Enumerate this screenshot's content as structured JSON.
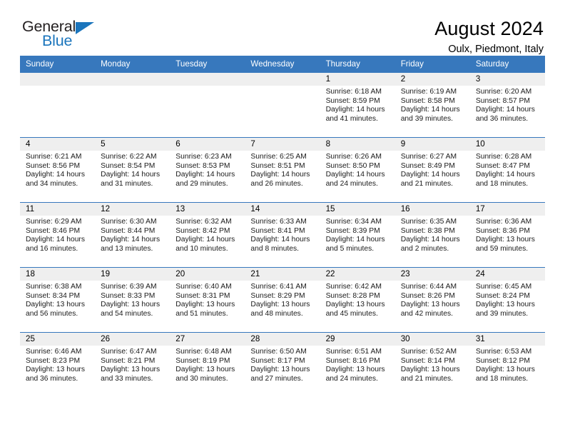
{
  "brand": {
    "name_top": "General",
    "name_bottom": "Blue",
    "accent_color": "#1b75bc"
  },
  "header": {
    "title": "August 2024",
    "subtitle": "Oulx, Piedmont, Italy"
  },
  "calendar": {
    "header_bg": "#3778bd",
    "daynum_bg": "#efefef",
    "weekdays": [
      "Sunday",
      "Monday",
      "Tuesday",
      "Wednesday",
      "Thursday",
      "Friday",
      "Saturday"
    ],
    "weeks": [
      [
        {
          "day": "",
          "empty": true
        },
        {
          "day": "",
          "empty": true
        },
        {
          "day": "",
          "empty": true
        },
        {
          "day": "",
          "empty": true
        },
        {
          "day": "1",
          "sunrise": "Sunrise: 6:18 AM",
          "sunset": "Sunset: 8:59 PM",
          "daylight1": "Daylight: 14 hours",
          "daylight2": "and 41 minutes."
        },
        {
          "day": "2",
          "sunrise": "Sunrise: 6:19 AM",
          "sunset": "Sunset: 8:58 PM",
          "daylight1": "Daylight: 14 hours",
          "daylight2": "and 39 minutes."
        },
        {
          "day": "3",
          "sunrise": "Sunrise: 6:20 AM",
          "sunset": "Sunset: 8:57 PM",
          "daylight1": "Daylight: 14 hours",
          "daylight2": "and 36 minutes."
        }
      ],
      [
        {
          "day": "4",
          "sunrise": "Sunrise: 6:21 AM",
          "sunset": "Sunset: 8:56 PM",
          "daylight1": "Daylight: 14 hours",
          "daylight2": "and 34 minutes."
        },
        {
          "day": "5",
          "sunrise": "Sunrise: 6:22 AM",
          "sunset": "Sunset: 8:54 PM",
          "daylight1": "Daylight: 14 hours",
          "daylight2": "and 31 minutes."
        },
        {
          "day": "6",
          "sunrise": "Sunrise: 6:23 AM",
          "sunset": "Sunset: 8:53 PM",
          "daylight1": "Daylight: 14 hours",
          "daylight2": "and 29 minutes."
        },
        {
          "day": "7",
          "sunrise": "Sunrise: 6:25 AM",
          "sunset": "Sunset: 8:51 PM",
          "daylight1": "Daylight: 14 hours",
          "daylight2": "and 26 minutes."
        },
        {
          "day": "8",
          "sunrise": "Sunrise: 6:26 AM",
          "sunset": "Sunset: 8:50 PM",
          "daylight1": "Daylight: 14 hours",
          "daylight2": "and 24 minutes."
        },
        {
          "day": "9",
          "sunrise": "Sunrise: 6:27 AM",
          "sunset": "Sunset: 8:49 PM",
          "daylight1": "Daylight: 14 hours",
          "daylight2": "and 21 minutes."
        },
        {
          "day": "10",
          "sunrise": "Sunrise: 6:28 AM",
          "sunset": "Sunset: 8:47 PM",
          "daylight1": "Daylight: 14 hours",
          "daylight2": "and 18 minutes."
        }
      ],
      [
        {
          "day": "11",
          "sunrise": "Sunrise: 6:29 AM",
          "sunset": "Sunset: 8:46 PM",
          "daylight1": "Daylight: 14 hours",
          "daylight2": "and 16 minutes."
        },
        {
          "day": "12",
          "sunrise": "Sunrise: 6:30 AM",
          "sunset": "Sunset: 8:44 PM",
          "daylight1": "Daylight: 14 hours",
          "daylight2": "and 13 minutes."
        },
        {
          "day": "13",
          "sunrise": "Sunrise: 6:32 AM",
          "sunset": "Sunset: 8:42 PM",
          "daylight1": "Daylight: 14 hours",
          "daylight2": "and 10 minutes."
        },
        {
          "day": "14",
          "sunrise": "Sunrise: 6:33 AM",
          "sunset": "Sunset: 8:41 PM",
          "daylight1": "Daylight: 14 hours",
          "daylight2": "and 8 minutes."
        },
        {
          "day": "15",
          "sunrise": "Sunrise: 6:34 AM",
          "sunset": "Sunset: 8:39 PM",
          "daylight1": "Daylight: 14 hours",
          "daylight2": "and 5 minutes."
        },
        {
          "day": "16",
          "sunrise": "Sunrise: 6:35 AM",
          "sunset": "Sunset: 8:38 PM",
          "daylight1": "Daylight: 14 hours",
          "daylight2": "and 2 minutes."
        },
        {
          "day": "17",
          "sunrise": "Sunrise: 6:36 AM",
          "sunset": "Sunset: 8:36 PM",
          "daylight1": "Daylight: 13 hours",
          "daylight2": "and 59 minutes."
        }
      ],
      [
        {
          "day": "18",
          "sunrise": "Sunrise: 6:38 AM",
          "sunset": "Sunset: 8:34 PM",
          "daylight1": "Daylight: 13 hours",
          "daylight2": "and 56 minutes."
        },
        {
          "day": "19",
          "sunrise": "Sunrise: 6:39 AM",
          "sunset": "Sunset: 8:33 PM",
          "daylight1": "Daylight: 13 hours",
          "daylight2": "and 54 minutes."
        },
        {
          "day": "20",
          "sunrise": "Sunrise: 6:40 AM",
          "sunset": "Sunset: 8:31 PM",
          "daylight1": "Daylight: 13 hours",
          "daylight2": "and 51 minutes."
        },
        {
          "day": "21",
          "sunrise": "Sunrise: 6:41 AM",
          "sunset": "Sunset: 8:29 PM",
          "daylight1": "Daylight: 13 hours",
          "daylight2": "and 48 minutes."
        },
        {
          "day": "22",
          "sunrise": "Sunrise: 6:42 AM",
          "sunset": "Sunset: 8:28 PM",
          "daylight1": "Daylight: 13 hours",
          "daylight2": "and 45 minutes."
        },
        {
          "day": "23",
          "sunrise": "Sunrise: 6:44 AM",
          "sunset": "Sunset: 8:26 PM",
          "daylight1": "Daylight: 13 hours",
          "daylight2": "and 42 minutes."
        },
        {
          "day": "24",
          "sunrise": "Sunrise: 6:45 AM",
          "sunset": "Sunset: 8:24 PM",
          "daylight1": "Daylight: 13 hours",
          "daylight2": "and 39 minutes."
        }
      ],
      [
        {
          "day": "25",
          "sunrise": "Sunrise: 6:46 AM",
          "sunset": "Sunset: 8:23 PM",
          "daylight1": "Daylight: 13 hours",
          "daylight2": "and 36 minutes."
        },
        {
          "day": "26",
          "sunrise": "Sunrise: 6:47 AM",
          "sunset": "Sunset: 8:21 PM",
          "daylight1": "Daylight: 13 hours",
          "daylight2": "and 33 minutes."
        },
        {
          "day": "27",
          "sunrise": "Sunrise: 6:48 AM",
          "sunset": "Sunset: 8:19 PM",
          "daylight1": "Daylight: 13 hours",
          "daylight2": "and 30 minutes."
        },
        {
          "day": "28",
          "sunrise": "Sunrise: 6:50 AM",
          "sunset": "Sunset: 8:17 PM",
          "daylight1": "Daylight: 13 hours",
          "daylight2": "and 27 minutes."
        },
        {
          "day": "29",
          "sunrise": "Sunrise: 6:51 AM",
          "sunset": "Sunset: 8:16 PM",
          "daylight1": "Daylight: 13 hours",
          "daylight2": "and 24 minutes."
        },
        {
          "day": "30",
          "sunrise": "Sunrise: 6:52 AM",
          "sunset": "Sunset: 8:14 PM",
          "daylight1": "Daylight: 13 hours",
          "daylight2": "and 21 minutes."
        },
        {
          "day": "31",
          "sunrise": "Sunrise: 6:53 AM",
          "sunset": "Sunset: 8:12 PM",
          "daylight1": "Daylight: 13 hours",
          "daylight2": "and 18 minutes."
        }
      ]
    ]
  }
}
